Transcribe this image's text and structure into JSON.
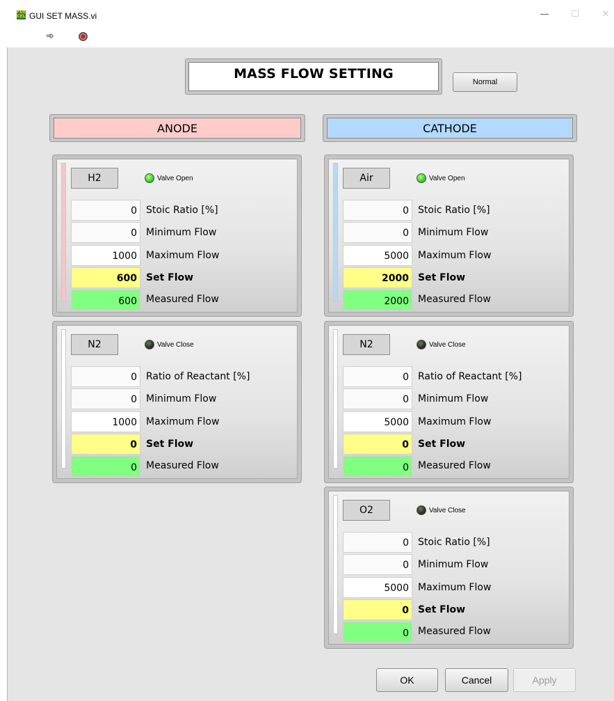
{
  "window": {
    "title": "GUI SET MASS.vi",
    "icon_text": "FUEL CELL",
    "min_glyph": "—",
    "max_glyph": "☐",
    "close_glyph": "✕"
  },
  "toolbar": {
    "run_icon": "run-arrow-icon",
    "run_glyph": "➾",
    "stop_icon": "abort-execution-icon"
  },
  "main_title": "MASS FLOW SETTING",
  "mode_button": "Normal",
  "anode": {
    "header": "ANODE",
    "accent_color": "#ffcccc",
    "sections": [
      {
        "gas": "H2",
        "valve_status": "Valve Open",
        "valve_on": true,
        "strip_color": "#f4c7c7",
        "rows": [
          {
            "value": "0",
            "label": "Stoic Ratio [%]"
          },
          {
            "value": "0",
            "label": "Minimum Flow"
          },
          {
            "value": "1000",
            "label": "Maximum Flow"
          },
          {
            "value": "600",
            "label": "Set Flow"
          },
          {
            "value": "600",
            "label": "Measured Flow"
          }
        ]
      },
      {
        "gas": "N2",
        "valve_status": "Valve Close",
        "valve_on": false,
        "strip_color": "#ffffff",
        "rows": [
          {
            "value": "0",
            "label": "Ratio of Reactant [%]"
          },
          {
            "value": "0",
            "label": "Minimum Flow"
          },
          {
            "value": "1000",
            "label": "Maximum Flow"
          },
          {
            "value": "0",
            "label": "Set Flow"
          },
          {
            "value": "0",
            "label": "Measured Flow"
          }
        ]
      }
    ]
  },
  "cathode": {
    "header": "CATHODE",
    "accent_color": "#b3d9ff",
    "sections": [
      {
        "gas": "Air",
        "valve_status": "Valve Open",
        "valve_on": true,
        "strip_color": "#b9d8f5",
        "rows": [
          {
            "value": "0",
            "label": "Stoic Ratio [%]"
          },
          {
            "value": "0",
            "label": "Minimum Flow"
          },
          {
            "value": "5000",
            "label": "Maximum Flow"
          },
          {
            "value": "2000",
            "label": "Set Flow"
          },
          {
            "value": "2000",
            "label": "Measured Flow"
          }
        ]
      },
      {
        "gas": "N2",
        "valve_status": "Valve Close",
        "valve_on": false,
        "strip_color": "#ffffff",
        "rows": [
          {
            "value": "0",
            "label": "Ratio of Reactant [%]"
          },
          {
            "value": "0",
            "label": "Minimum Flow"
          },
          {
            "value": "5000",
            "label": "Maximum Flow"
          },
          {
            "value": "0",
            "label": "Set Flow"
          },
          {
            "value": "0",
            "label": "Measured Flow"
          }
        ]
      },
      {
        "gas": "O2",
        "valve_status": "Valve Close",
        "valve_on": false,
        "strip_color": "#ffffff",
        "rows": [
          {
            "value": "0",
            "label": "Stoic Ratio [%]"
          },
          {
            "value": "0",
            "label": "Minimum Flow"
          },
          {
            "value": "5000",
            "label": "Maximum Flow"
          },
          {
            "value": "0",
            "label": "Set Flow"
          },
          {
            "value": "0",
            "label": "Measured Flow"
          }
        ]
      }
    ]
  },
  "dialog_buttons": {
    "ok": "OK",
    "cancel": "Cancel",
    "apply": "Apply"
  },
  "colors": {
    "set_flow_bg": "#ffff88",
    "measured_flow_bg": "#80ff80",
    "led_on": "#3fd32c",
    "led_off": "#26301e"
  }
}
